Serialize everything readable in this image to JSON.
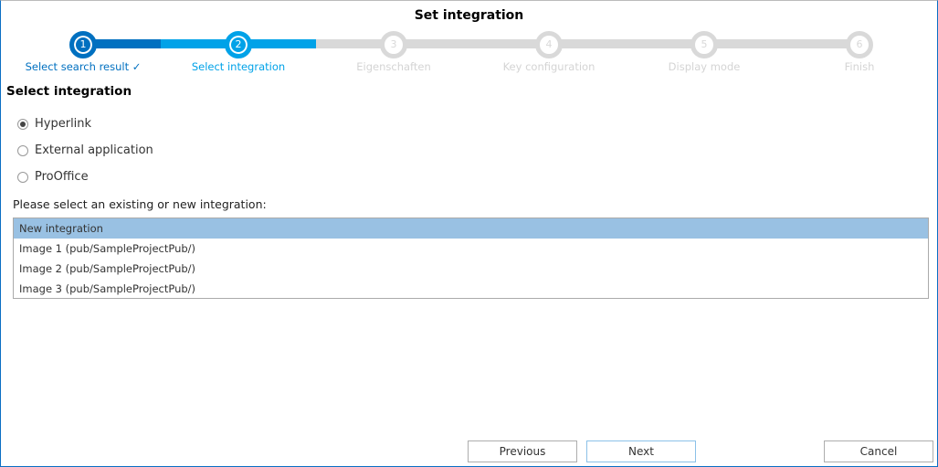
{
  "title": "Set integration",
  "steps": [
    {
      "num": "1",
      "label": "Select search result ✓",
      "state": "done"
    },
    {
      "num": "2",
      "label": "Select integration",
      "state": "cur"
    },
    {
      "num": "3",
      "label": "Eigenschaften",
      "state": "todo"
    },
    {
      "num": "4",
      "label": "Key configuration",
      "state": "todo"
    },
    {
      "num": "5",
      "label": "Display mode",
      "state": "todo"
    },
    {
      "num": "6",
      "label": "Finish",
      "state": "todo"
    }
  ],
  "section_heading": "Select integration",
  "options": [
    {
      "label": "Hyperlink",
      "checked": true
    },
    {
      "label": "External application",
      "checked": false
    },
    {
      "label": "ProOffice",
      "checked": false
    }
  ],
  "prompt": "Please select an existing or new integration:",
  "list": [
    "New integration",
    "Image 1 (pub/SampleProjectPub/)",
    "Image 2 (pub/SampleProjectPub/)",
    "Image 3 (pub/SampleProjectPub/)"
  ],
  "buttons": {
    "previous": "Previous",
    "next": "Next",
    "cancel": "Cancel"
  },
  "colors": {
    "done": "#0070c0",
    "current": "#00a2e8",
    "todo": "#d9d9d9",
    "selected_row": "#99c1e3"
  }
}
